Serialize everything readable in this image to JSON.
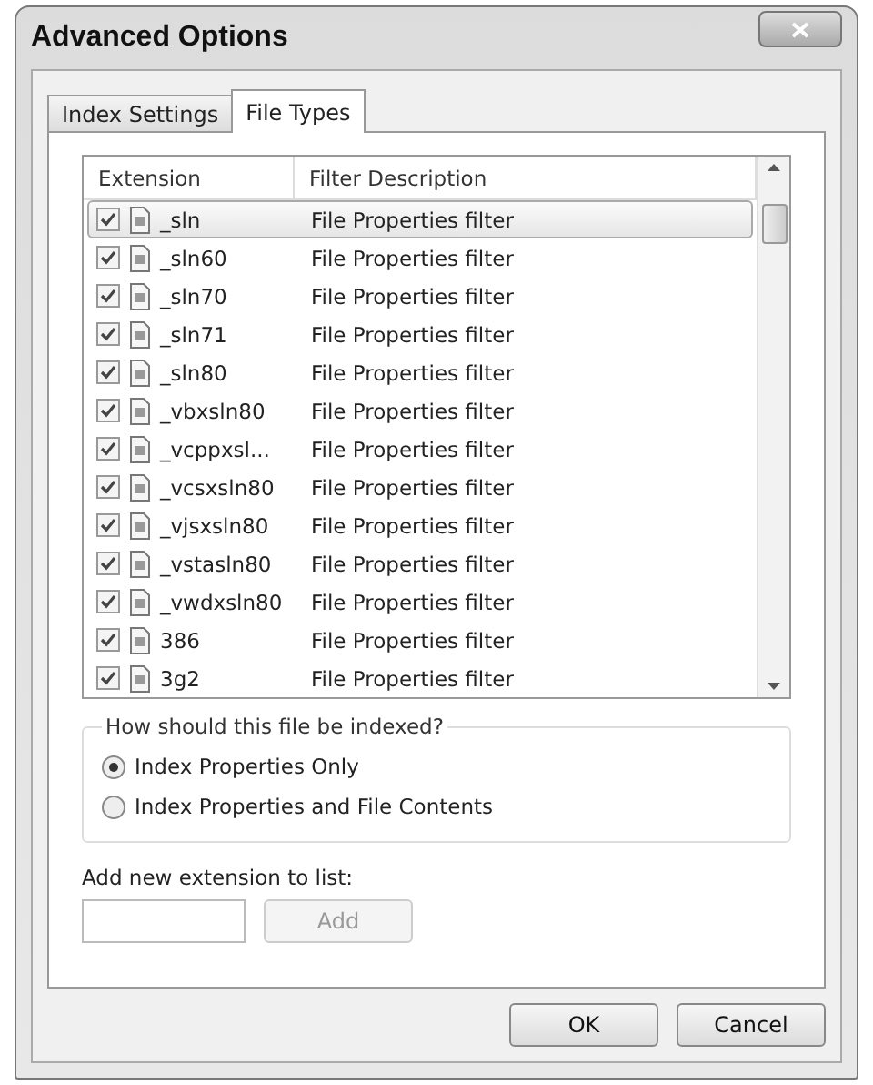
{
  "window": {
    "title": "Advanced Options"
  },
  "tabs": [
    {
      "label": "Index Settings",
      "selected": false
    },
    {
      "label": "File Types",
      "selected": true
    }
  ],
  "list": {
    "columns": [
      "Extension",
      "Filter Description"
    ],
    "rows": [
      {
        "extension": "_sln",
        "description": "File Properties filter",
        "checked": true,
        "selected": true
      },
      {
        "extension": "_sln60",
        "description": "File Properties filter",
        "checked": true,
        "selected": false
      },
      {
        "extension": "_sln70",
        "description": "File Properties filter",
        "checked": true,
        "selected": false
      },
      {
        "extension": "_sln71",
        "description": "File Properties filter",
        "checked": true,
        "selected": false
      },
      {
        "extension": "_sln80",
        "description": "File Properties filter",
        "checked": true,
        "selected": false
      },
      {
        "extension": "_vbxsln80",
        "description": "File Properties filter",
        "checked": true,
        "selected": false
      },
      {
        "extension": "_vcppxsl...",
        "description": "File Properties filter",
        "checked": true,
        "selected": false
      },
      {
        "extension": "_vcsxsln80",
        "description": "File Properties filter",
        "checked": true,
        "selected": false
      },
      {
        "extension": "_vjsxsln80",
        "description": "File Properties filter",
        "checked": true,
        "selected": false
      },
      {
        "extension": "_vstasln80",
        "description": "File Properties filter",
        "checked": true,
        "selected": false
      },
      {
        "extension": "_vwdxsln80",
        "description": "File Properties filter",
        "checked": true,
        "selected": false
      },
      {
        "extension": "386",
        "description": "File Properties filter",
        "checked": true,
        "selected": false
      },
      {
        "extension": "3g2",
        "description": "File Properties filter",
        "checked": true,
        "selected": false
      }
    ]
  },
  "index_group": {
    "title": "How should this file be indexed?",
    "options": [
      {
        "label": "Index Properties Only",
        "selected": true
      },
      {
        "label": "Index Properties and File Contents",
        "selected": false
      }
    ]
  },
  "add_extension": {
    "label": "Add new extension to list:",
    "button": "Add",
    "button_disabled": true
  },
  "buttons": [
    "OK",
    "Cancel"
  ]
}
